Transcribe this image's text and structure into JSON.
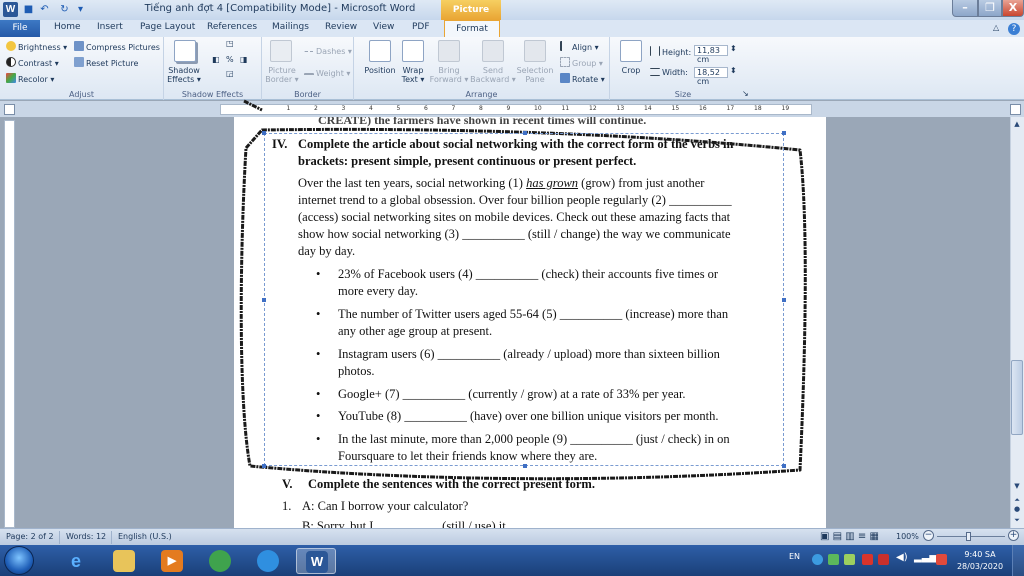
{
  "window": {
    "title": "Tiếng anh đợt 4 [Compatibility Mode]  -  Microsoft Word",
    "contextual_tab_group": "Picture Tools",
    "minimize_label": "–",
    "maximize_label": "❐",
    "close_label": "X"
  },
  "tabs": {
    "file": "File",
    "home": "Home",
    "insert": "Insert",
    "page_layout": "Page Layout",
    "references": "References",
    "mailings": "Mailings",
    "review": "Review",
    "view": "View",
    "pdf": "PDF",
    "format": "Format"
  },
  "ribbon": {
    "adjust": {
      "label": "Adjust",
      "brightness": "Brightness ▾",
      "contrast": "Contrast ▾",
      "recolor": "Recolor ▾",
      "compress": "Compress Pictures",
      "reset": "Reset Picture"
    },
    "shadow": {
      "label": "Shadow Effects",
      "shadow_effects_1": "Shadow",
      "shadow_effects_2": "Effects ▾"
    },
    "border": {
      "label": "Border",
      "dashes": "Dashes ▾",
      "weight": "Weight ▾",
      "picture_border_1": "Picture",
      "picture_border_2": "Border ▾"
    },
    "arrange": {
      "label": "Arrange",
      "position": "Position",
      "wrap_1": "Wrap",
      "wrap_2": "Text ▾",
      "bring_1": "Bring",
      "bring_2": "Forward ▾",
      "send_1": "Send",
      "send_2": "Backward ▾",
      "selection_1": "Selection",
      "selection_2": "Pane",
      "align": "Align ▾",
      "group": "Group ▾",
      "rotate": "Rotate ▾"
    },
    "size": {
      "label": "Size",
      "crop": "Crop",
      "height_label": "Height:",
      "height_value": "11,83 cm",
      "width_label": "Width:",
      "width_value": "18,52 cm"
    }
  },
  "ruler": {
    "numbers": [
      "1",
      "2",
      "3",
      "4",
      "5",
      "6",
      "7",
      "8",
      "9",
      "10",
      "11",
      "12",
      "13",
      "14",
      "15",
      "16",
      "17",
      "18",
      "19"
    ]
  },
  "document": {
    "top_cut_line": "CREATE) the farmers have shown in recent times will continue.",
    "section4_num": "IV.",
    "section4_title_1": "Complete the article about social networking with the correct form of the verbs in",
    "section4_title_2": "brackets: present simple, present continuous or present perfect.",
    "para": [
      "Over the last ten years, social networking (1)",
      "has grown",
      "(grow) from just another",
      "internet trend to a global obsession. Over four billion people regularly (2) __________",
      "(access) social networking sites on mobile devices. Check out these amazing facts that",
      "show how social networking (3) __________ (still / change) the way we communicate",
      "day by day."
    ],
    "bullets": [
      [
        "23% of Facebook users (4) __________ (check) their accounts five times or",
        "more every day."
      ],
      [
        "The number of Twitter users aged 55-64 (5) __________ (increase) more than",
        "any other age group at present."
      ],
      [
        "Instagram users (6) __________ (already / upload) more than sixteen billion",
        "photos."
      ],
      [
        "Google+ (7) __________ (currently / grow) at a rate of 33% per year."
      ],
      [
        "YouTube (8) __________ (have) over one billion unique visitors per month."
      ],
      [
        "In the last minute, more than 2,000 people (9) __________ (just / check) in on",
        "Foursquare to let their friends know where they are."
      ]
    ],
    "bullet_char": "•",
    "section5_num": "V.",
    "section5_title": "Complete the sentences with the correct present form.",
    "q1_num": "1.",
    "q1_text": "A: Can I borrow your calculator?",
    "q1_b_cut": "B: Sorry, but I __________ (still / use) it."
  },
  "statusbar": {
    "page": "Page: 2 of 2",
    "words": "Words: 12",
    "language": "English (U.S.)",
    "zoom": "100%"
  },
  "taskbar": {
    "language": "EN",
    "time": "9:40 SA",
    "date": "28/03/2020"
  }
}
